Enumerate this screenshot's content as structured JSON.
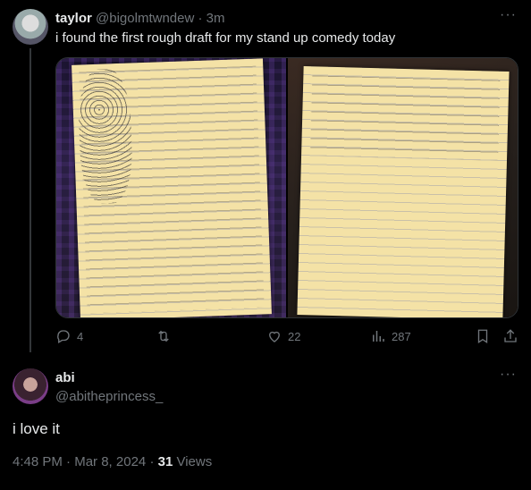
{
  "tweet": {
    "display_name": "taylor",
    "handle": "@bigolmtwndew",
    "separator": "·",
    "time_ago": "3m",
    "text": "i found the first rough draft for my stand up comedy today",
    "stats": {
      "replies": "4",
      "retweets": "",
      "likes": "22",
      "views": "287"
    }
  },
  "reply": {
    "display_name": "abi",
    "handle": "@abitheprincess_",
    "text": "i love it",
    "time": "4:48 PM",
    "date_separator": "·",
    "date": "Mar 8, 2024",
    "views_separator": "·",
    "views_count": "31",
    "views_label": "Views"
  },
  "icons": {
    "more": "more-icon",
    "reply": "reply-icon",
    "retweet": "retweet-icon",
    "like": "heart-icon",
    "views": "views-icon",
    "bookmark": "bookmark-icon",
    "share": "share-icon"
  },
  "colors": {
    "background": "#000000",
    "text": "#e7e9ea",
    "muted": "#71767b",
    "border": "#2f3336"
  }
}
